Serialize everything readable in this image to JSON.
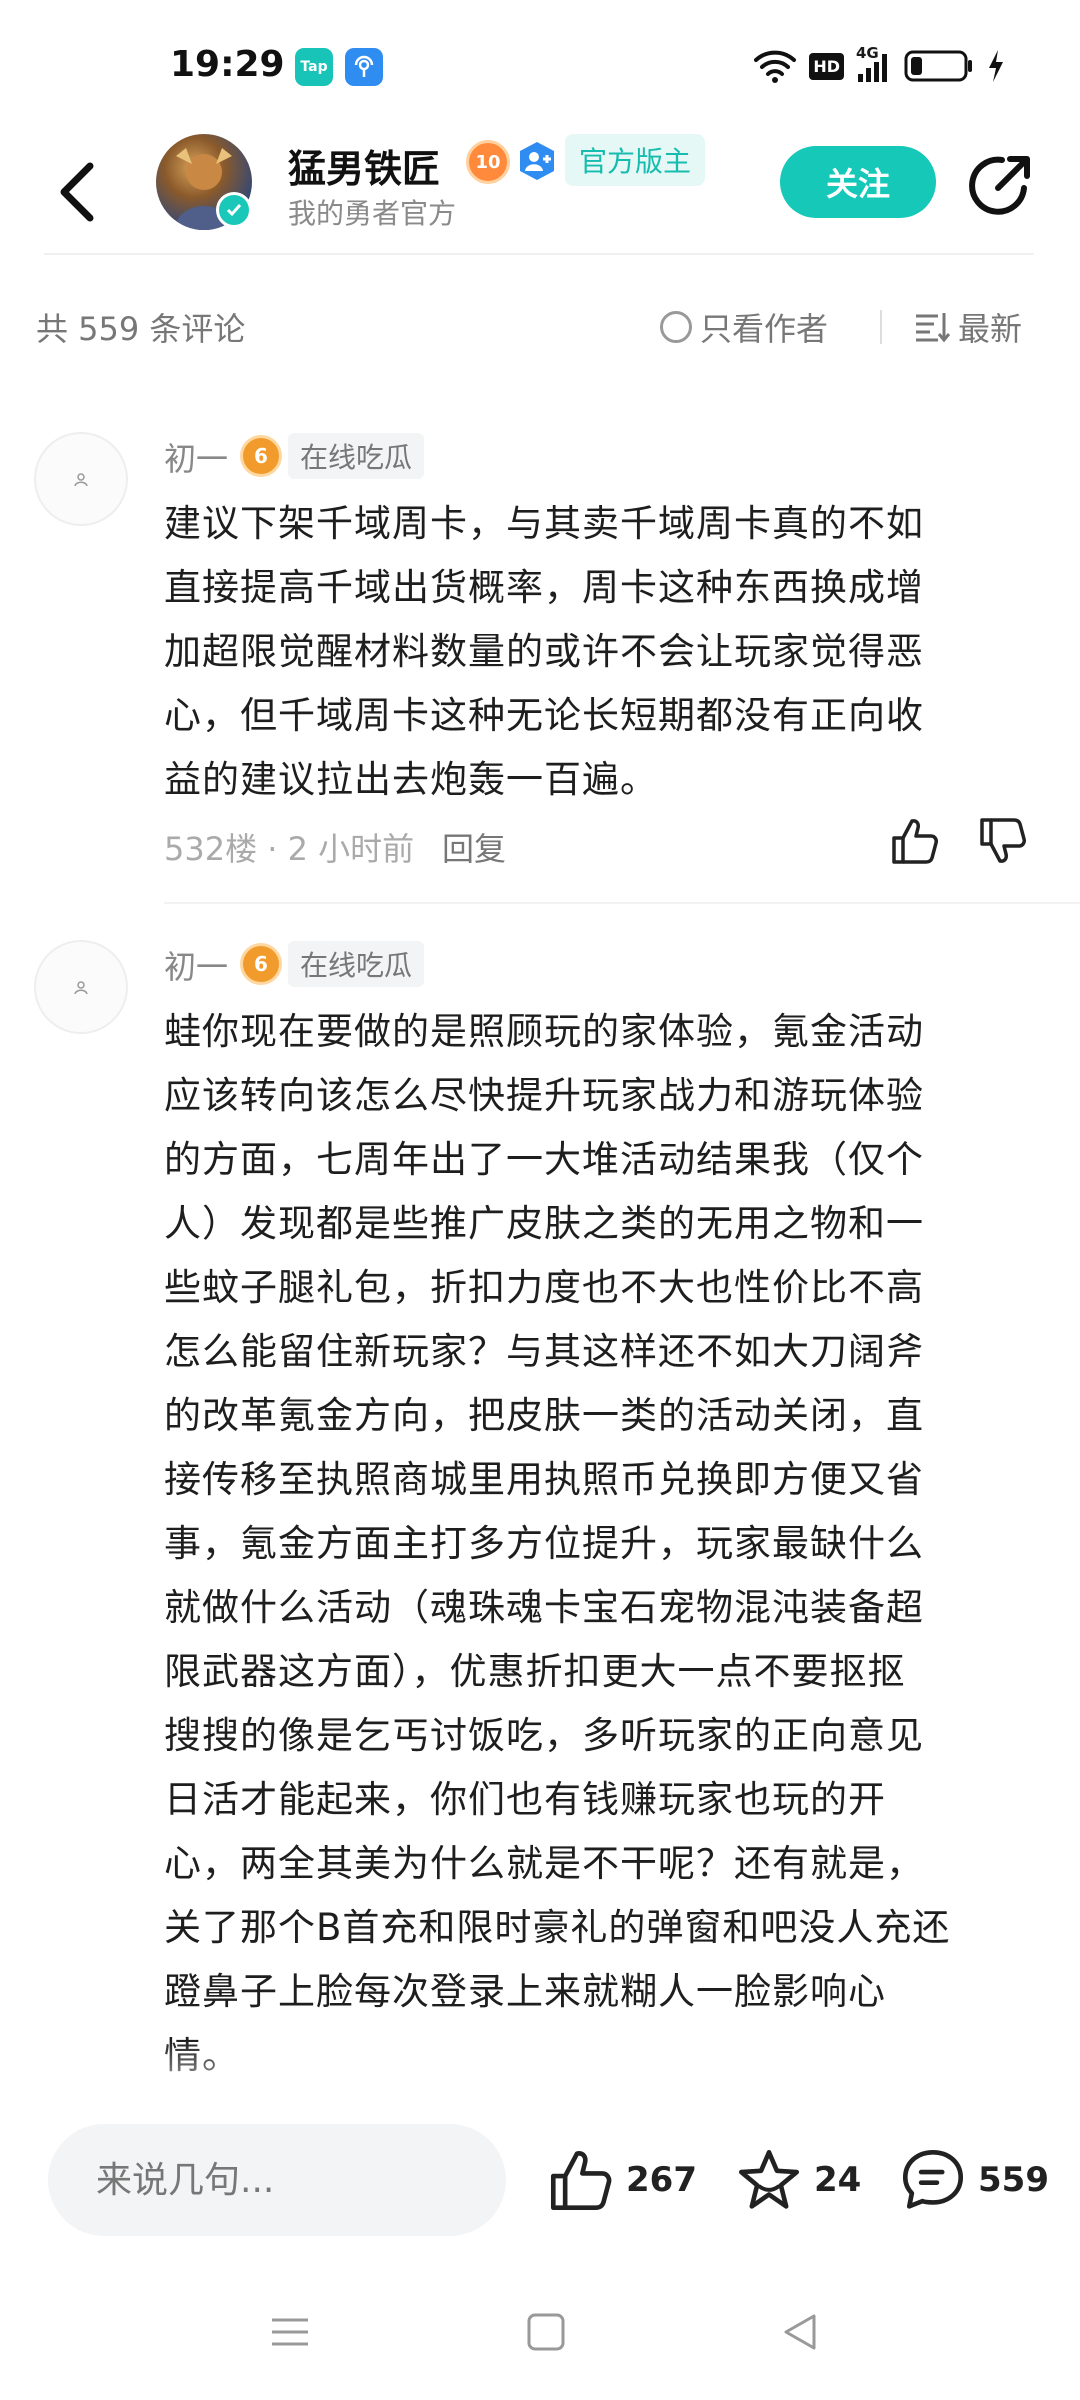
{
  "status_bar": {
    "time": "19:29",
    "apps": [
      {
        "name": "taptap-app-icon",
        "label": "Tap",
        "color": "#18c3b7"
      },
      {
        "name": "network-app-icon",
        "label": "",
        "color": "#2f8cf0"
      }
    ],
    "network": "4G",
    "hd": "HD",
    "battery_level": 0.2
  },
  "header": {
    "author_name": "猛男铁匠",
    "level": "10",
    "mod_tag": "官方版主",
    "subtitle": "我的勇者官方",
    "follow_label": "关注"
  },
  "sort_bar": {
    "count_text": "共 559 条评论",
    "author_only_label": "只看作者",
    "sort_label": "最新"
  },
  "comments": [
    {
      "user": "初一",
      "level": "6",
      "tag": "在线吃瓜",
      "text": "建议下架千域周卡，与其卖千域周卡真的不如\n直接提高千域出货概率，周卡这种东西换成增\n加超限觉醒材料数量的或许不会让玩家觉得恶\n心，但千域周卡这种无论长短期都没有正向收\n益的建议拉出去炮轰一百遍。",
      "meta": "532楼 · 2 小时前",
      "reply_label": "回复"
    },
    {
      "user": "初一",
      "level": "6",
      "tag": "在线吃瓜",
      "text": "蛙你现在要做的是照顾玩的家体验，氪金活动\n应该转向该怎么尽快提升玩家战力和游玩体验\n的方面，七周年出了一大堆活动结果我（仅个\n人）发现都是些推广皮肤之类的无用之物和一\n些蚊子腿礼包，折扣力度也不大也性价比不高\n怎么能留住新玩家？与其这样还不如大刀阔斧\n的改革氪金方向，把皮肤一类的活动关闭，直\n接传移至执照商城里用执照币兑换即方便又省\n事，氪金方面主打多方位提升，玩家最缺什么\n就做什么活动（魂珠魂卡宝石宠物混沌装备超\n限武器这方面），优惠折扣更大一点不要抠抠\n搜搜的像是乞丐讨饭吃，多听玩家的正向意见\n日活才能起来，你们也有钱赚玩家也玩的开\n心，两全其美为什么就是不干呢？还有就是，\n关了那个B首充和限时豪礼的弹窗和吧没人充还\n蹬鼻子上脸每次登录上来就糊人一脸影响心\n情。"
    }
  ],
  "bottom_bar": {
    "input_placeholder": "来说几句...",
    "likes": "267",
    "favorites": "24",
    "comments": "559"
  },
  "colors": {
    "accent": "#15c8b8",
    "level_orange": "#f29b2d"
  }
}
